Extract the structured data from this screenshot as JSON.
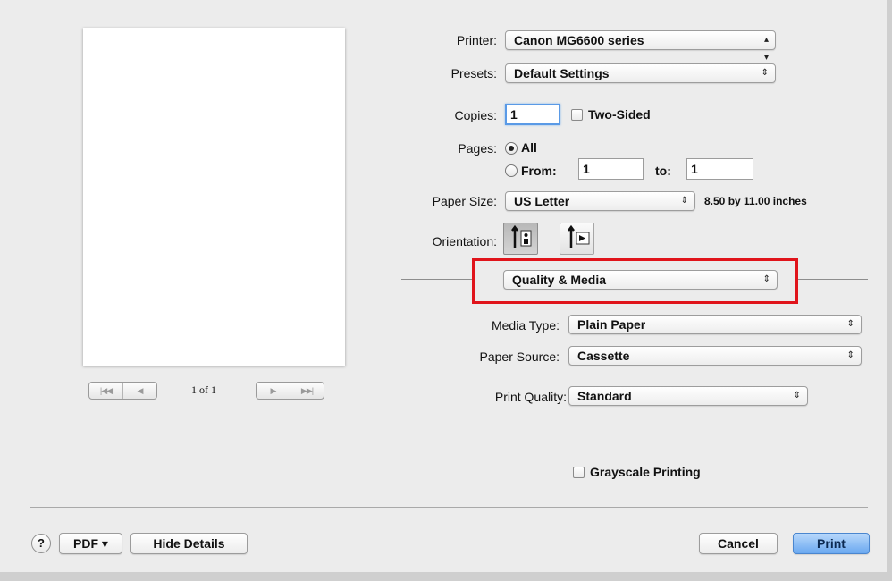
{
  "preview": {
    "page_indicator": "1 of 1",
    "nav_first": "|◀◀",
    "nav_prev": "◀",
    "nav_next": "▶",
    "nav_last": "▶▶|"
  },
  "printer": {
    "label": "Printer:",
    "value": "Canon MG6600 series"
  },
  "presets": {
    "label": "Presets:",
    "value": "Default Settings"
  },
  "copies": {
    "label": "Copies:",
    "value": "1",
    "two_sided_label": "Two-Sided",
    "two_sided_checked": false
  },
  "pages": {
    "label": "Pages:",
    "all_label": "All",
    "from_label": "From:",
    "from_value": "1",
    "to_label": "to:",
    "to_value": "1",
    "selected": "All"
  },
  "paper_size": {
    "label": "Paper Size:",
    "value": "US Letter",
    "dimensions": "8.50 by 11.00 inches"
  },
  "orientation": {
    "label": "Orientation:",
    "selected": "portrait"
  },
  "section_popup": {
    "value": "Quality & Media"
  },
  "media_type": {
    "label": "Media Type:",
    "value": "Plain Paper"
  },
  "paper_source": {
    "label": "Paper Source:",
    "value": "Cassette"
  },
  "print_quality": {
    "label": "Print Quality:",
    "value": "Standard"
  },
  "grayscale": {
    "label": "Grayscale Printing",
    "checked": false
  },
  "footer": {
    "help": "?",
    "pdf_label": "PDF ▾",
    "hide_details_label": "Hide Details",
    "cancel_label": "Cancel",
    "print_label": "Print"
  },
  "colors": {
    "highlight": "#e0141b",
    "default_button": "#6aa8f0",
    "focus_ring": "#5a9ae6"
  },
  "icons": [
    "portrait-orientation-icon",
    "landscape-orientation-icon",
    "popup-arrows-icon",
    "help-icon"
  ]
}
